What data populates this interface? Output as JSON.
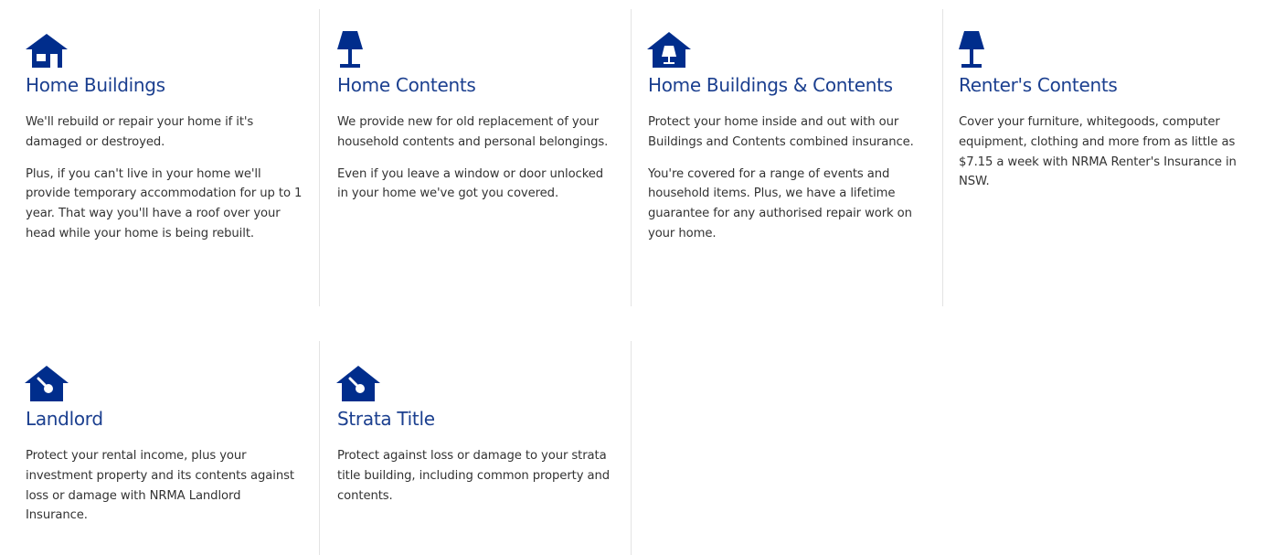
{
  "colors": {
    "brand_blue": "#002d8c",
    "title_blue": "#1b3f8f",
    "text": "#333333",
    "divider": "#e3e3e3"
  },
  "products": [
    {
      "icon": "house-icon",
      "title": "Home Buildings",
      "paragraphs": [
        "We'll rebuild or repair your home if it's damaged or destroyed.",
        "Plus, if you can't live in your home we'll provide temporary accommodation for up to 1 year. That way you'll have a roof over your head while your home is being rebuilt."
      ]
    },
    {
      "icon": "lamp-icon",
      "title": "Home Contents",
      "paragraphs": [
        "We provide new for old replacement of your household contents and personal belongings.",
        "Even if you leave a window or door unlocked in your home we've got you covered."
      ]
    },
    {
      "icon": "house-lamp-icon",
      "title": "Home Buildings & Contents",
      "paragraphs": [
        "Protect your home inside and out with our Buildings and Contents combined insurance.",
        "You're covered for a range of events and household items. Plus, we have a lifetime guarantee for any authorised repair work on your home."
      ]
    },
    {
      "icon": "lamp-icon",
      "title": "Renter's Contents",
      "paragraphs": [
        "Cover your furniture, whitegoods, computer equipment, clothing and more from as little as $7.15 a week with NRMA Renter's Insurance in NSW."
      ]
    },
    {
      "icon": "house-key-icon",
      "title": "Landlord",
      "paragraphs": [
        "Protect your rental income, plus your investment property and its contents against loss or damage with NRMA Landlord Insurance."
      ]
    },
    {
      "icon": "house-key-icon",
      "title": "Strata Title",
      "paragraphs": [
        "Protect against loss or damage to your strata title building, including common property and contents."
      ]
    }
  ]
}
